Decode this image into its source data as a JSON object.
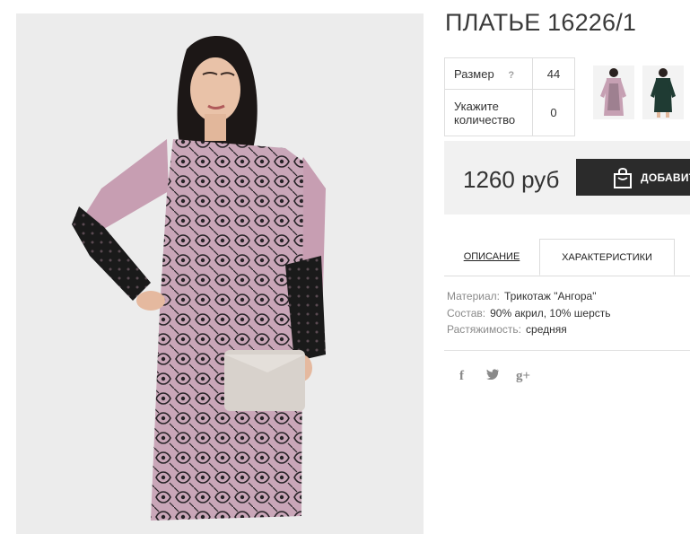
{
  "product": {
    "title": "ПЛАТЬЕ 16226/1",
    "image": "product-photo-woman-in-lace-dress"
  },
  "options": {
    "size_label": "Размер",
    "size_help": "?",
    "size_value": "44",
    "qty_label": "Укажите количество",
    "qty_value": "0"
  },
  "thumbnails": [
    "thumbnail-pink-lace-dress",
    "thumbnail-dark-green-dress"
  ],
  "purchase": {
    "price": "1260 руб",
    "add_button": "ДОБАВИТЬ",
    "icon": "shopping-bag-icon"
  },
  "tabs": [
    {
      "label": "ОПИСАНИЕ",
      "active": false
    },
    {
      "label": "ХАРАКТЕРИСТИКИ",
      "active": true
    }
  ],
  "specs": [
    {
      "key": "Материал:",
      "value": "Трикотаж \"Ангора\""
    },
    {
      "key": "Состав:",
      "value": "90% акрил, 10% шерсть"
    },
    {
      "key": "Растяжимость:",
      "value": "средняя"
    }
  ],
  "social": {
    "facebook": "f",
    "twitter": "twitter-icon",
    "googleplus": "g+"
  },
  "colors": {
    "button_bg": "#2b2b2b",
    "price_bg": "#f1f1f1",
    "dress_pink": "#c8a3b6",
    "lace_black": "#1e1e1e",
    "dark_green": "#1f3b33"
  }
}
